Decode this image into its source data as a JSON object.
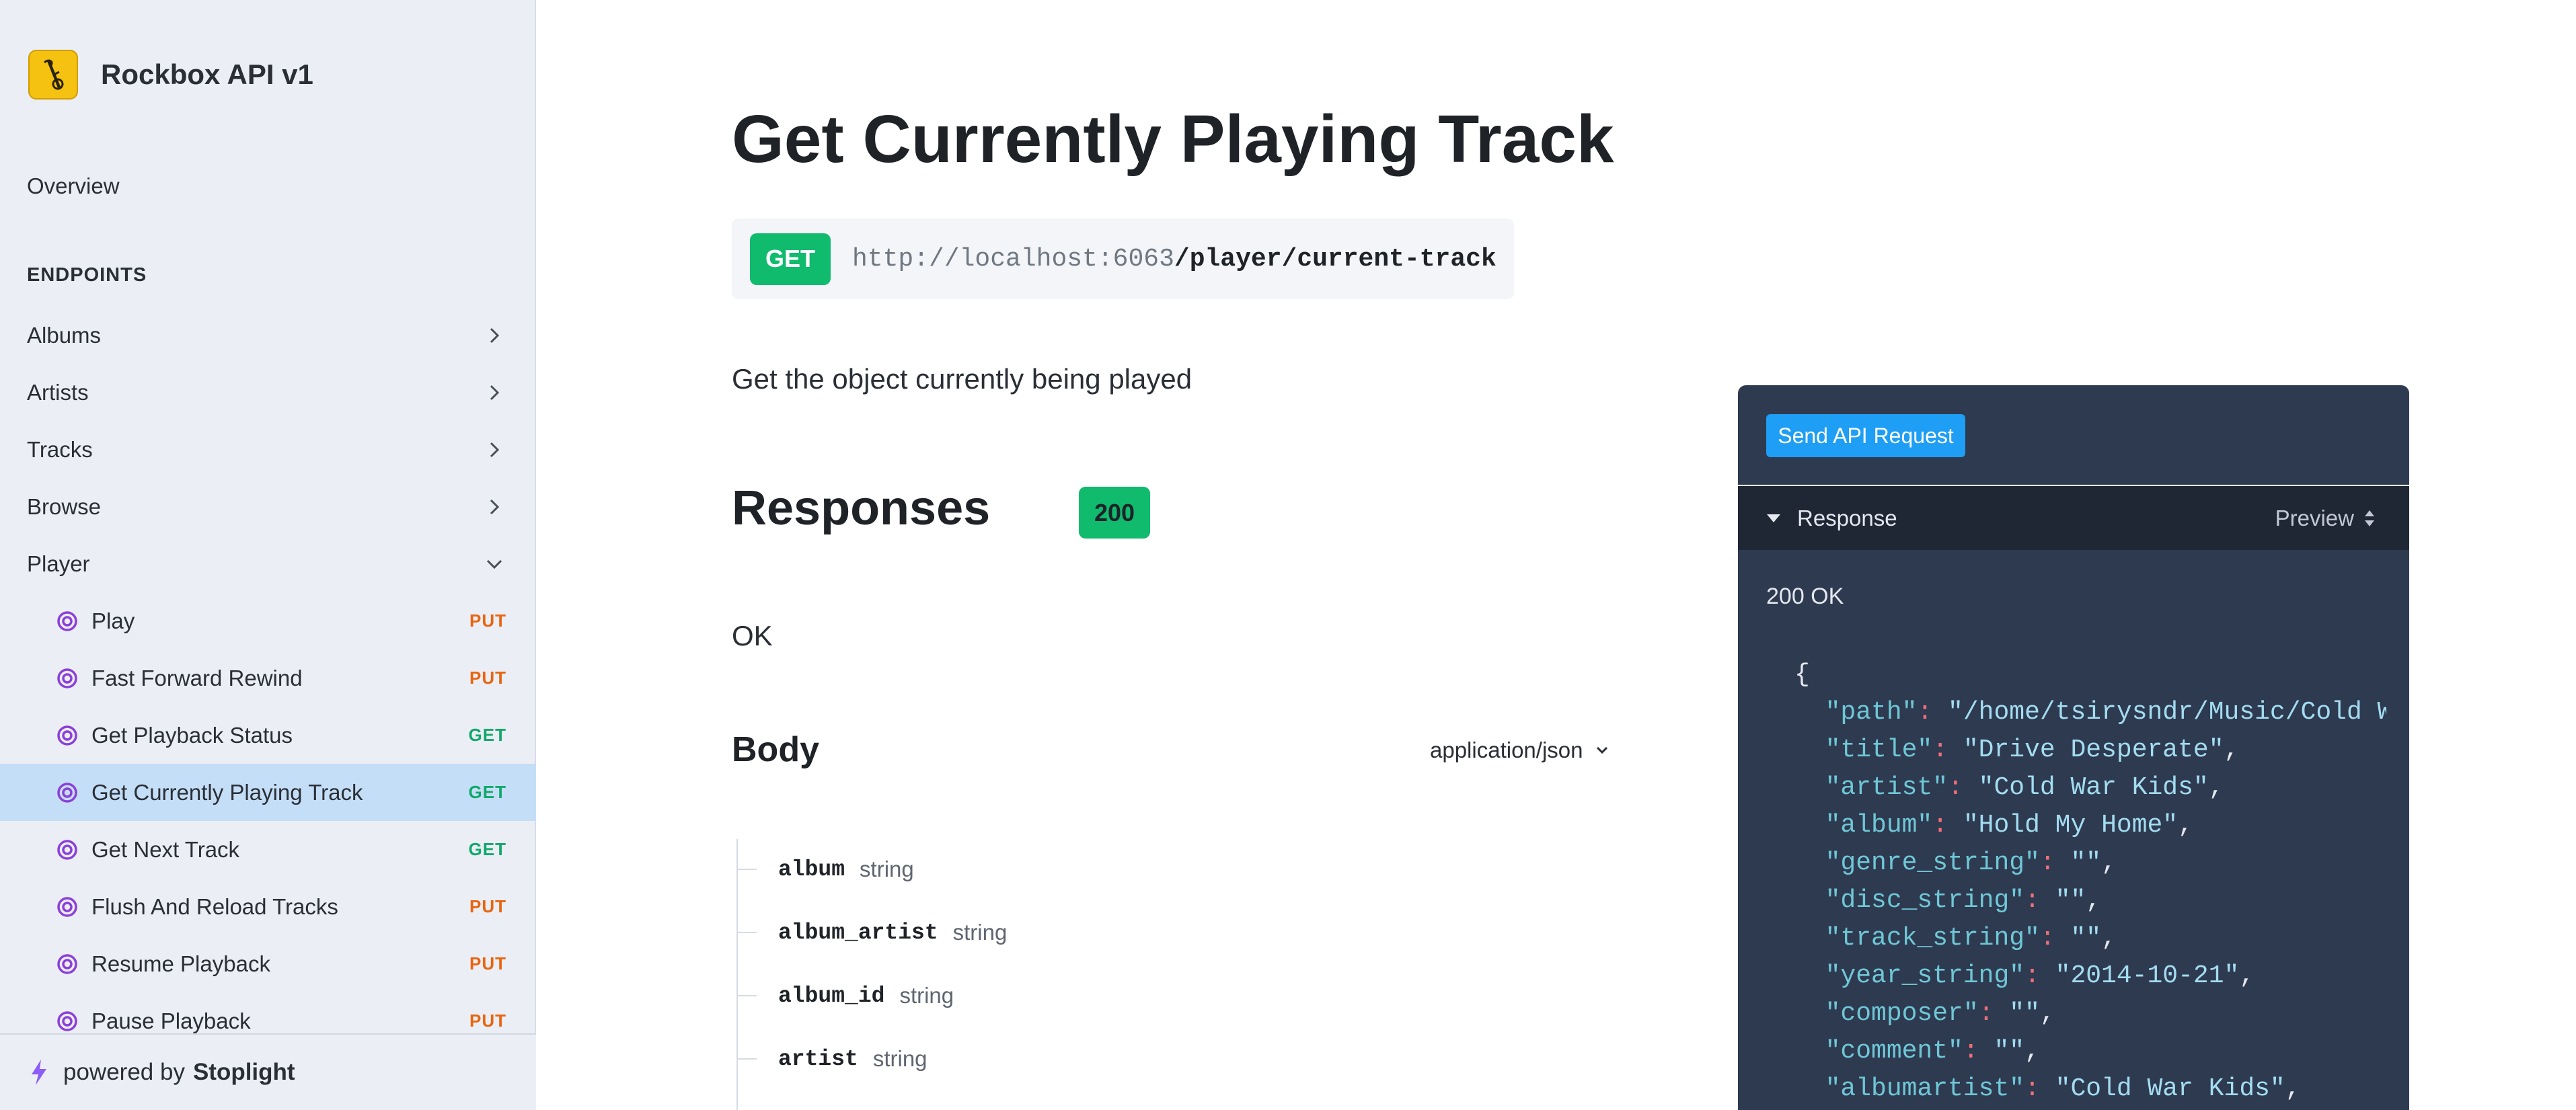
{
  "sidebar": {
    "title": "Rockbox API v1",
    "overview": "Overview",
    "section_heading": "ENDPOINTS",
    "groups": [
      {
        "label": "Albums",
        "expanded": false
      },
      {
        "label": "Artists",
        "expanded": false
      },
      {
        "label": "Tracks",
        "expanded": false
      },
      {
        "label": "Browse",
        "expanded": false
      },
      {
        "label": "Player",
        "expanded": true
      }
    ],
    "items": [
      {
        "label": "Play",
        "method": "PUT"
      },
      {
        "label": "Fast Forward Rewind",
        "method": "PUT"
      },
      {
        "label": "Get Playback Status",
        "method": "GET"
      },
      {
        "label": "Get Currently Playing Track",
        "method": "GET",
        "active": true
      },
      {
        "label": "Get Next Track",
        "method": "GET"
      },
      {
        "label": "Flush And Reload Tracks",
        "method": "PUT"
      },
      {
        "label": "Resume Playback",
        "method": "PUT"
      },
      {
        "label": "Pause Playback",
        "method": "PUT"
      }
    ],
    "powered_prefix": "powered by",
    "powered_brand": "Stoplight"
  },
  "main": {
    "title": "Get Currently Playing Track",
    "method": "GET",
    "base_url": "http://localhost:6063",
    "path": "/player/current-track",
    "description": "Get the object currently being played",
    "responses_title": "Responses",
    "status_code": "200",
    "status_text": "OK",
    "body_title": "Body",
    "content_type": "application/json",
    "fields": [
      {
        "name": "album",
        "type": "string"
      },
      {
        "name": "album_artist",
        "type": "string"
      },
      {
        "name": "album_id",
        "type": "string"
      },
      {
        "name": "artist",
        "type": "string"
      }
    ]
  },
  "tryit": {
    "send_label": "Send API Request",
    "response_label": "Response",
    "preview_label": "Preview",
    "status_line": "200 OK",
    "json_open": "{",
    "json_lines": [
      {
        "key": "\"path\"",
        "value": "\"/home/tsirysndr/Music/Cold W"
      },
      {
        "key": "\"title\"",
        "value": "\"Drive Desperate\""
      },
      {
        "key": "\"artist\"",
        "value": "\"Cold War Kids\""
      },
      {
        "key": "\"album\"",
        "value": "\"Hold My Home\""
      },
      {
        "key": "\"genre_string\"",
        "value": "\"\""
      },
      {
        "key": "\"disc_string\"",
        "value": "\"\""
      },
      {
        "key": "\"track_string\"",
        "value": "\"\""
      },
      {
        "key": "\"year_string\"",
        "value": "\"2014-10-21\""
      },
      {
        "key": "\"composer\"",
        "value": "\"\""
      },
      {
        "key": "\"comment\"",
        "value": "\"\""
      },
      {
        "key": "\"albumartist\"",
        "value": "\"Cold War Kids\""
      }
    ]
  },
  "colors": {
    "get": "#10bb6e",
    "put": "#e8650f",
    "active_row": "#c5def7",
    "send_button": "#1e9ef4",
    "panel": "#2e3a50"
  }
}
